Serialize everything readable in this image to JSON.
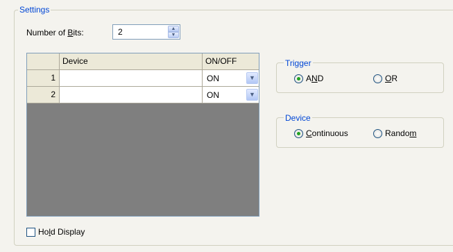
{
  "settings": {
    "legend": "Settings",
    "bits": {
      "label_pre": "Number of ",
      "label_mnemonic": "B",
      "label_post": "its:",
      "value": "2"
    },
    "table": {
      "columns": [
        "",
        "Device",
        "ON/OFF"
      ],
      "rows": [
        {
          "num": "1",
          "device": "",
          "state": "ON"
        },
        {
          "num": "2",
          "device": "",
          "state": "ON"
        }
      ]
    },
    "trigger": {
      "legend": "Trigger",
      "and": {
        "pre": "A",
        "mnemonic": "N",
        "post": "D",
        "selected": true
      },
      "or": {
        "pre": "",
        "mnemonic": "O",
        "post": "R",
        "selected": false
      }
    },
    "device": {
      "legend": "Device",
      "continuous": {
        "pre": "",
        "mnemonic": "C",
        "post": "ontinuous",
        "selected": true
      },
      "random": {
        "pre": "Rando",
        "mnemonic": "m",
        "post": "",
        "selected": false
      }
    },
    "hold": {
      "pre": "Ho",
      "mnemonic": "l",
      "post": "d Display",
      "checked": false
    }
  }
}
